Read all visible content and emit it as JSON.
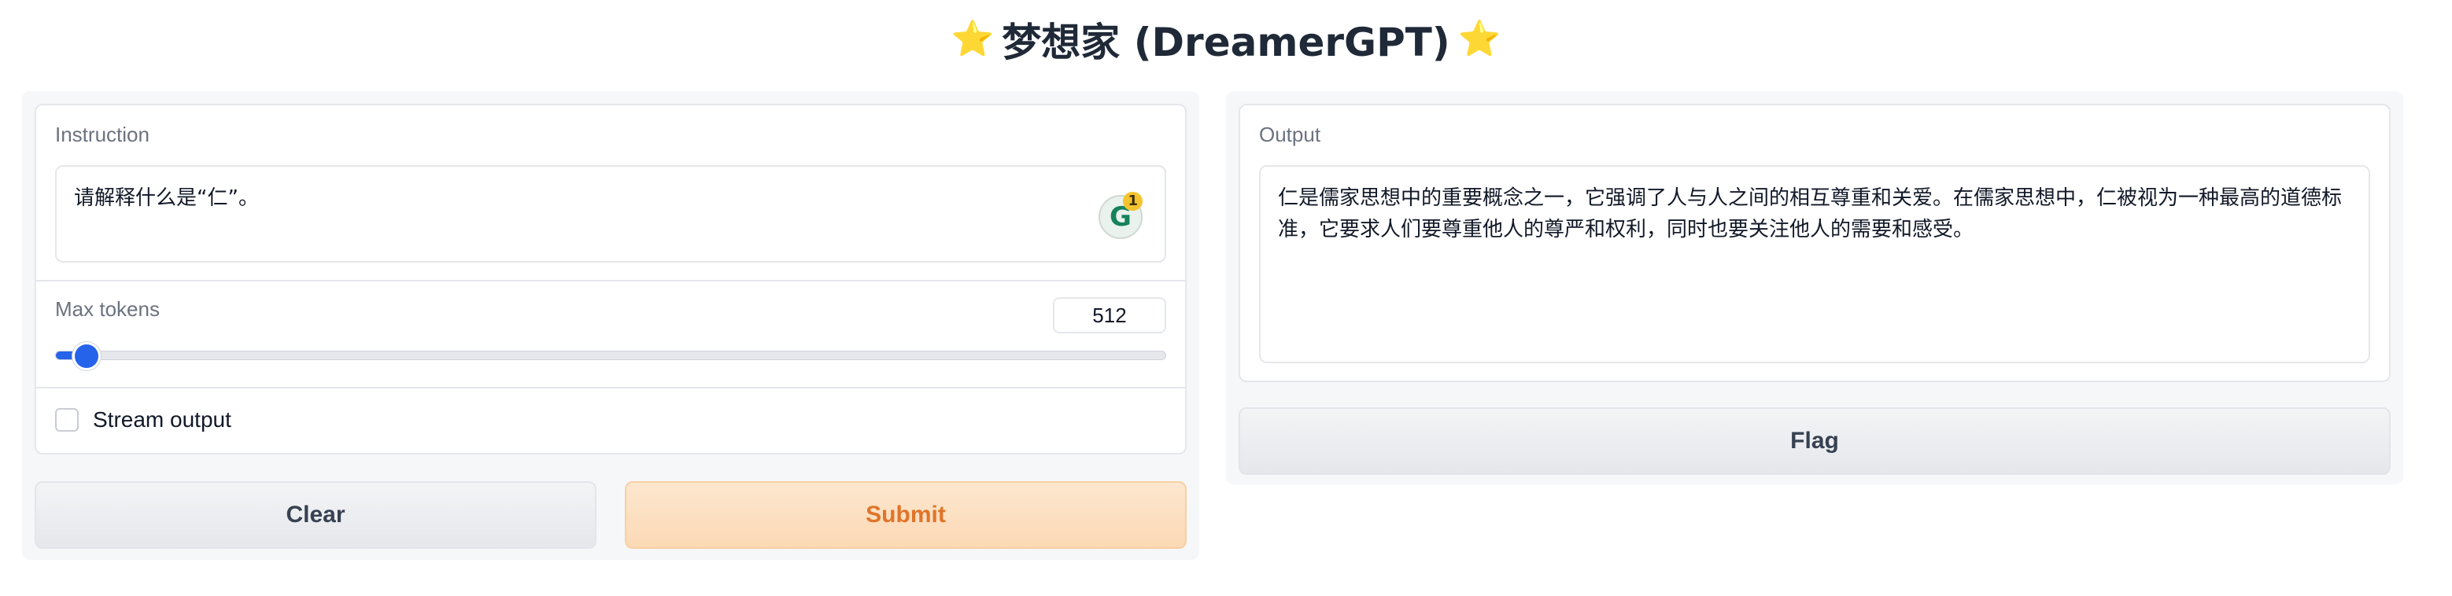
{
  "app": {
    "title": "梦想家 (DreamerGPT)",
    "title_icon": "star-emoji"
  },
  "instruction": {
    "label": "Instruction",
    "value": "请解释什么是“仁”。",
    "grammarly_badge": "1"
  },
  "max_tokens": {
    "label": "Max tokens",
    "value": "512",
    "slider_fraction": 0.018
  },
  "stream": {
    "label": "Stream output",
    "checked": false
  },
  "buttons": {
    "clear": "Clear",
    "submit": "Submit",
    "flag": "Flag"
  },
  "output": {
    "label": "Output",
    "value": "仁是儒家思想中的重要概念之一，它强调了人与人之间的相互尊重和关爱。在儒家思想中，仁被视为一种最高的道德标准，它要求人们要尊重他人的尊严和权利，同时也要关注他人的需要和感受。"
  },
  "colors": {
    "accent": "#2563eb",
    "primary_button_text": "#e0742a",
    "primary_button_bg": "#fbd9b5"
  }
}
